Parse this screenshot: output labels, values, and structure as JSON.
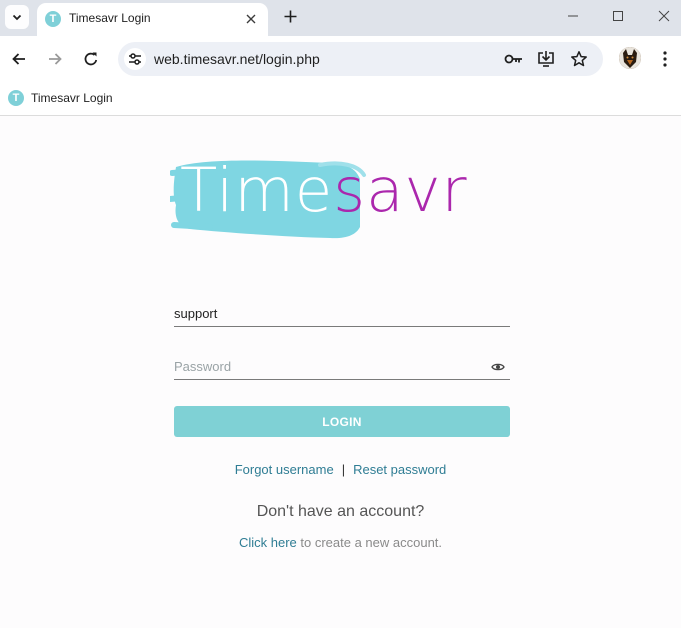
{
  "browser": {
    "tab": {
      "title": "Timesavr Login",
      "favicon_letter": "T"
    },
    "url": "web.timesavr.net/login.php",
    "bookmarks": [
      {
        "label": "Timesavr Login",
        "favicon_letter": "T"
      }
    ],
    "icons": {
      "tab_search": "chevron-down-icon",
      "tab_close": "close-icon",
      "new_tab": "plus-icon",
      "minimize": "minimize-icon",
      "maximize": "maximize-icon",
      "close_window": "close-icon",
      "back": "arrow-left-icon",
      "forward": "arrow-right-icon",
      "reload": "reload-icon",
      "site_info": "tune-icon",
      "password_manager": "key-icon",
      "install": "install-icon",
      "bookmark_star": "star-icon",
      "menu": "kebab-menu-icon"
    }
  },
  "login": {
    "logo": {
      "part1": "Time",
      "part2": "savr"
    },
    "username_value": "support",
    "password_placeholder": "Password",
    "login_button": "LOGIN",
    "forgot_username": "Forgot username",
    "separator": "|",
    "reset_password": "Reset password",
    "no_account": "Don't have an account?",
    "click_here": "Click here",
    "create_suffix": " to create a new account."
  },
  "colors": {
    "brand_teal": "#7fd1d5",
    "brand_purple": "#ab27ad",
    "link": "#2f7d94"
  }
}
